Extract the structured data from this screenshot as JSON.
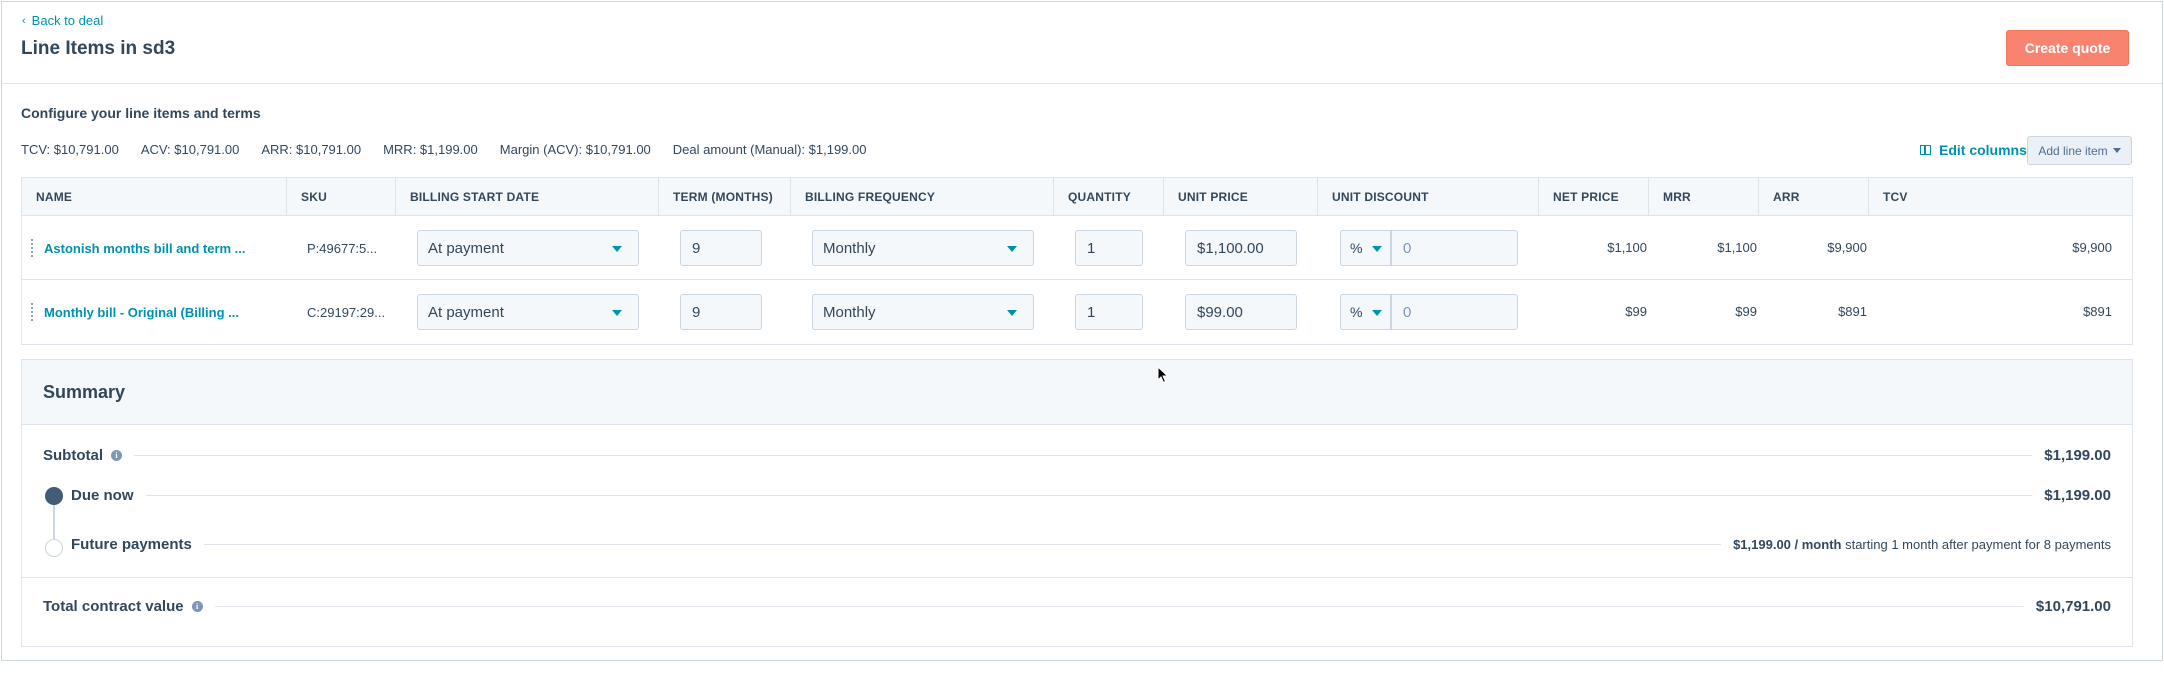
{
  "header": {
    "back_label": "Back to deal",
    "title": "Line Items in sd3",
    "create_quote_label": "Create quote"
  },
  "config": {
    "title": "Configure your line items and terms",
    "metrics": [
      "TCV: $10,791.00",
      "ACV: $10,791.00",
      "ARR: $10,791.00",
      "MRR: $1,199.00",
      "Margin (ACV): $10,791.00",
      "Deal amount (Manual): $1,199.00"
    ],
    "edit_columns_label": "Edit columns",
    "add_line_item_label": "Add line item"
  },
  "table": {
    "columns": [
      "NAME",
      "SKU",
      "BILLING START DATE",
      "TERM (MONTHS)",
      "BILLING FREQUENCY",
      "QUANTITY",
      "UNIT PRICE",
      "UNIT DISCOUNT",
      "NET PRICE",
      "MRR",
      "ARR",
      "TCV"
    ],
    "rows": [
      {
        "name": "Astonish months bill and term ...",
        "sku": "P:49677:5...",
        "billing_start": "At payment",
        "term": "9",
        "frequency": "Monthly",
        "quantity": "1",
        "unit_price": "$1,100.00",
        "discount_type": "%",
        "discount_placeholder": "0",
        "net_price": "$1,100",
        "mrr": "$1,100",
        "arr": "$9,900",
        "tcv": "$9,900"
      },
      {
        "name": "Monthly bill - Original (Billing ...",
        "sku": "C:29197:29...",
        "billing_start": "At payment",
        "term": "9",
        "frequency": "Monthly",
        "quantity": "1",
        "unit_price": "$99.00",
        "discount_type": "%",
        "discount_placeholder": "0",
        "net_price": "$99",
        "mrr": "$99",
        "arr": "$891",
        "tcv": "$891"
      }
    ]
  },
  "summary": {
    "title": "Summary",
    "subtotal_label": "Subtotal",
    "subtotal_value": "$1,199.00",
    "due_now_label": "Due now",
    "due_now_value": "$1,199.00",
    "future_label": "Future payments",
    "future_amount": "$1,199.00 / month",
    "future_note": " starting 1 month after payment for 8 payments",
    "tcv_label": "Total contract value",
    "tcv_value": "$10,791.00"
  },
  "colors": {
    "accent": "#0091ae",
    "create_quote": "#f8846f",
    "text": "#33475b",
    "border": "#dfe3eb"
  }
}
